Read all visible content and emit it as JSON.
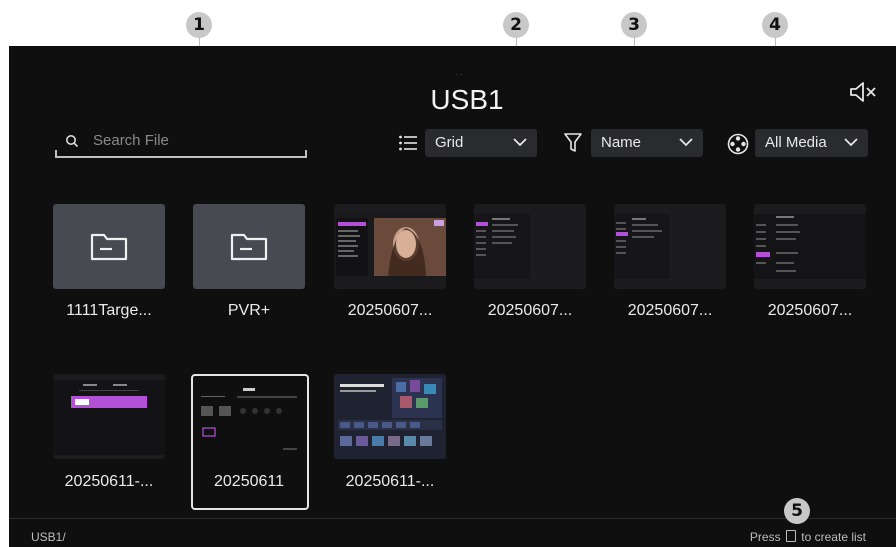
{
  "callouts": [
    "1",
    "2",
    "3",
    "4",
    "5"
  ],
  "header": {
    "title": "USB1"
  },
  "search": {
    "placeholder": "Search File"
  },
  "controls": {
    "view": "Grid",
    "sort": "Name",
    "filter": "All Media"
  },
  "items": [
    {
      "label": "1111Targe...",
      "type": "folder"
    },
    {
      "label": "PVR+",
      "type": "folder"
    },
    {
      "label": "20250607...",
      "type": "image"
    },
    {
      "label": "20250607...",
      "type": "image"
    },
    {
      "label": "20250607...",
      "type": "image"
    },
    {
      "label": "20250607...",
      "type": "image"
    },
    {
      "label": "20250611-...",
      "type": "image"
    },
    {
      "label": "20250611",
      "type": "image",
      "selected": true
    },
    {
      "label": "20250611-...",
      "type": "image"
    }
  ],
  "footer": {
    "path": "USB1/",
    "hint_before": "Press",
    "hint_after": "to create list"
  },
  "icons": {
    "mute": "mute-icon",
    "search": "search-icon",
    "view": "list-icon",
    "sort": "funnel-icon",
    "filter": "film-reel-icon",
    "folder": "folder-icon"
  }
}
